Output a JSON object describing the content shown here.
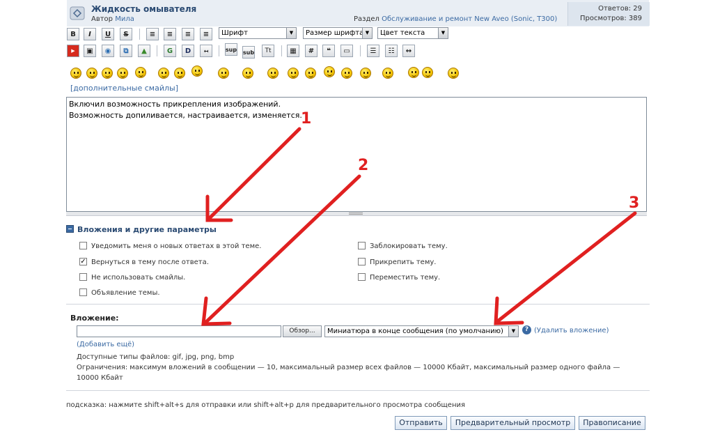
{
  "topic": {
    "title": "Жидкость омывателя",
    "author_prefix": "Автор",
    "author": "Мила",
    "section_prefix": "Раздел",
    "section": "Обслуживание и ремонт New Aveo (Sonic, T300)",
    "replies": "Ответов: 29",
    "views": "Просмотров: 389"
  },
  "toolbar": {
    "row1": [
      "B",
      "I",
      "U",
      "S"
    ],
    "font_select": "Шрифт",
    "size_select": "Размер шрифта",
    "color_select": "Цвет текста",
    "row2_text": [
      "sup",
      "sub",
      "Tt",
      "#"
    ]
  },
  "smilies": {
    "more_link": "[дополнительные смайлы]"
  },
  "editor": {
    "line1": "Включил возможность прикрепления изображений.",
    "line2": "Возможность допиливается, настраивается, изменяется."
  },
  "options": {
    "title": "Вложения и другие параметры",
    "left": [
      {
        "label": "Уведомить меня о новых ответах в этой теме.",
        "checked": false
      },
      {
        "label": "Вернуться в тему после ответа.",
        "checked": true
      },
      {
        "label": "Не использовать смайлы.",
        "checked": false
      },
      {
        "label": "Объявление темы.",
        "checked": false
      }
    ],
    "right": [
      {
        "label": "Заблокировать тему.",
        "checked": false
      },
      {
        "label": "Прикрепить тему.",
        "checked": false
      },
      {
        "label": "Переместить тему.",
        "checked": false
      }
    ]
  },
  "attachment": {
    "label": "Вложение:",
    "browse": "Обзор...",
    "mode": "Миниатюра в конце сообщения (по умолчанию)",
    "help": "?",
    "remove": "(Удалить вложение)",
    "add_more": "(Добавить ещё)",
    "types": "Доступные типы файлов: gif, jpg, png, bmp",
    "limits_1": "Ограничения: максимум вложений в сообщении — 10, максимальный размер всех файлов — 10000 Кбайт, максимальный размер одного файла —",
    "limits_2": "10000 Кбайт"
  },
  "hint": "подсказка: нажмите shift+alt+s для отправки или shift+alt+p для предварительного просмотра сообщения",
  "buttons": {
    "send": "Отправить",
    "preview": "Предварительный просмотр",
    "spell": "Правописание"
  },
  "annotations": [
    "1",
    "2",
    "3"
  ],
  "colors": {
    "arrow": "#e02020",
    "header_bg": "#e9eef4",
    "link": "#3b6aa3"
  }
}
